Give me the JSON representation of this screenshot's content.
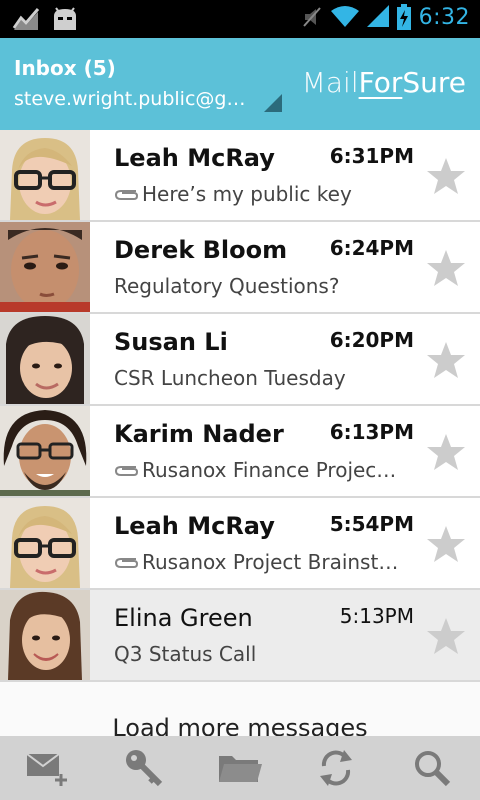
{
  "status_bar": {
    "time": "6:32",
    "icons": [
      "activity-icon",
      "android-bug-icon",
      "mute-icon",
      "wifi-icon",
      "signal-icon",
      "battery-charging-icon"
    ],
    "accent_color": "#33b5e5"
  },
  "action_bar": {
    "title": "Inbox (5)",
    "account": "steve.wright.public@g…",
    "brand_part1": "Mail",
    "brand_part2": "For",
    "brand_part3": "Sure",
    "color": "#5cc1d8"
  },
  "messages": [
    {
      "sender": "Leah McRay",
      "time": "6:31PM",
      "subject": "Here’s my public key",
      "attachment": true,
      "read": false
    },
    {
      "sender": "Derek Bloom",
      "time": "6:24PM",
      "subject": "Regulatory Questions?",
      "attachment": false,
      "read": false
    },
    {
      "sender": "Susan Li",
      "time": "6:20PM",
      "subject": "CSR Luncheon Tuesday",
      "attachment": false,
      "read": false
    },
    {
      "sender": "Karim Nader",
      "time": "6:13PM",
      "subject": "Rusanox Finance Projec…",
      "attachment": true,
      "read": false
    },
    {
      "sender": "Leah McRay",
      "time": "5:54PM",
      "subject": "Rusanox Project Brainst…",
      "attachment": true,
      "read": false
    },
    {
      "sender": "Elina Green",
      "time": "5:13PM",
      "subject": "Q3 Status Call",
      "attachment": false,
      "read": true
    }
  ],
  "load_more": "Load more messages",
  "bottom_bar": [
    "compose-icon",
    "key-icon",
    "folder-icon",
    "refresh-icon",
    "search-icon"
  ]
}
